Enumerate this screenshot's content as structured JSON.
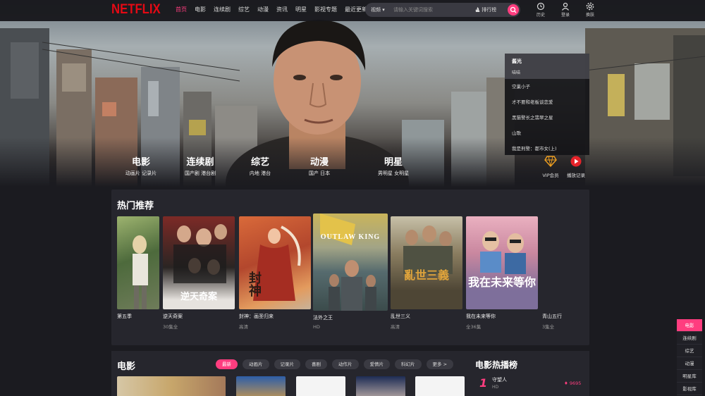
{
  "brand": {
    "logo": "NETFLIX",
    "accent": "#ff3d7f",
    "logo_color": "#e50914"
  },
  "nav": {
    "links": [
      "首页",
      "电影",
      "连续剧",
      "综艺",
      "动漫",
      "资讯",
      "明星",
      "影视专题",
      "最近更新"
    ],
    "active_index": 0
  },
  "search": {
    "scope": "视频 ▾",
    "placeholder": "请输入关键词搜索",
    "rank_label": "排行榜"
  },
  "user_icons": [
    {
      "icon": "history-icon",
      "label": "历史"
    },
    {
      "icon": "user-icon",
      "label": "登录"
    },
    {
      "icon": "settings-icon",
      "label": "换肤"
    }
  ],
  "hero_categories": [
    {
      "title": "电影",
      "sub": "动画片  记录片"
    },
    {
      "title": "连续剧",
      "sub": "国产剧  港台剧"
    },
    {
      "title": "综艺",
      "sub": "内地  港台"
    },
    {
      "title": "动漫",
      "sub": "国产  日本"
    },
    {
      "title": "明星",
      "sub": "男明星  女明星"
    }
  ],
  "dropdown": {
    "title": "酱光",
    "subtitle": "喵喵",
    "items": [
      "空巢小子",
      "才不要和老板谈恋爱",
      "黑猫警长之翡翠之星",
      "山歌",
      "我是刑警：都市女(上)"
    ]
  },
  "vip": [
    {
      "icon": "diamond-icon",
      "label": "VIP会员"
    },
    {
      "icon": "play-circle-icon",
      "label": "播放记录"
    }
  ],
  "hot": {
    "title": "热门推荐",
    "items": [
      {
        "name": "第五季",
        "sub": ""
      },
      {
        "name": "逆天奇案",
        "sub": "30集全",
        "poster_text": "逆天奇案"
      },
      {
        "name": "封神：画圣归来",
        "sub": "高清",
        "poster_text": "封神"
      },
      {
        "name": "法外之王",
        "sub": "HD",
        "poster_text": "OUTLAW KING"
      },
      {
        "name": "乱世三义",
        "sub": "高清",
        "poster_text": "亂世三義"
      },
      {
        "name": "我在未来等你",
        "sub": "全36集",
        "poster_text": "我在未来等你"
      },
      {
        "name": "青山五行",
        "sub": "3集全"
      }
    ]
  },
  "movie": {
    "title": "电影",
    "pills": [
      "最新",
      "动画片",
      "记录片",
      "喜剧",
      "动作片",
      "爱情片",
      "科幻片",
      "更多 >"
    ],
    "active_pill": 0,
    "rank_title": "电影热播榜",
    "rank_first": {
      "no": "1",
      "name": "守望人",
      "sub": "HD",
      "heat": "♦ 9695"
    }
  },
  "side_float": [
    "电影",
    "连续剧",
    "综艺",
    "动漫",
    "明星库",
    "影视库"
  ]
}
